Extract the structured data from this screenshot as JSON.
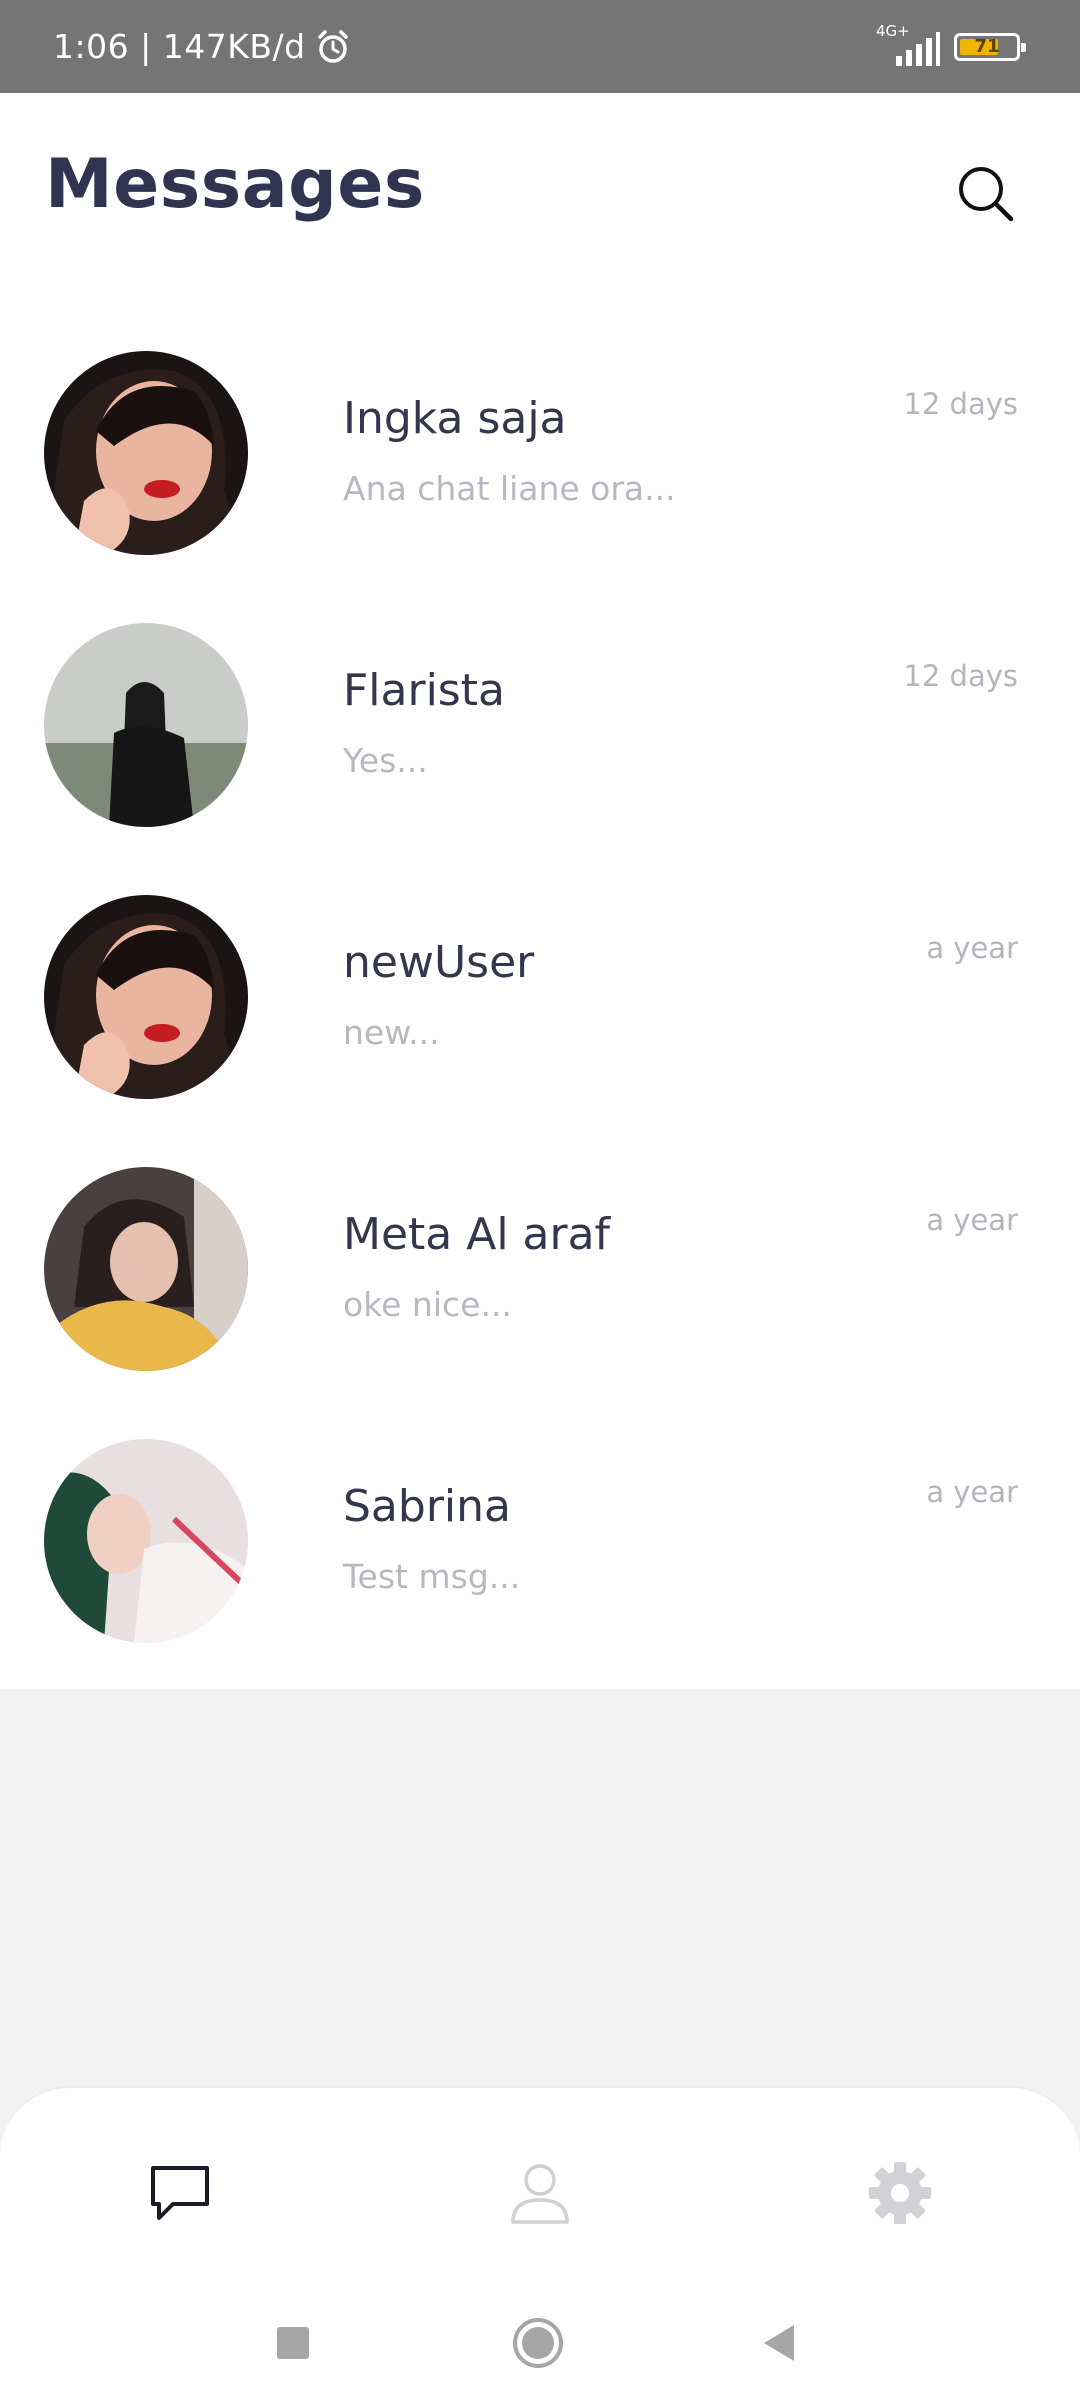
{
  "status_bar": {
    "time_speed": "1:06 | 147KB/d",
    "network_label": "4G+",
    "battery_level": "71"
  },
  "header": {
    "title": "Messages"
  },
  "conversations": [
    {
      "name": "Ingka saja",
      "preview": "Ana chat liane ora...",
      "time": "12 days"
    },
    {
      "name": "Flarista",
      "preview": "Yes...",
      "time": "12 days"
    },
    {
      "name": "newUser",
      "preview": "new...",
      "time": "a year"
    },
    {
      "name": "Meta Al araf",
      "preview": "oke nice...",
      "time": "a year"
    },
    {
      "name": "Sabrina",
      "preview": "Test msg...",
      "time": "a year"
    }
  ],
  "bottom_nav": {
    "items": [
      "chat-icon",
      "profile-icon",
      "settings-icon"
    ],
    "active_index": 0
  },
  "colors": {
    "title": "#2f3550",
    "name": "#33364d",
    "secondary": "#b8b8c0",
    "status_bar": "#757575",
    "battery": "#f0b400"
  }
}
